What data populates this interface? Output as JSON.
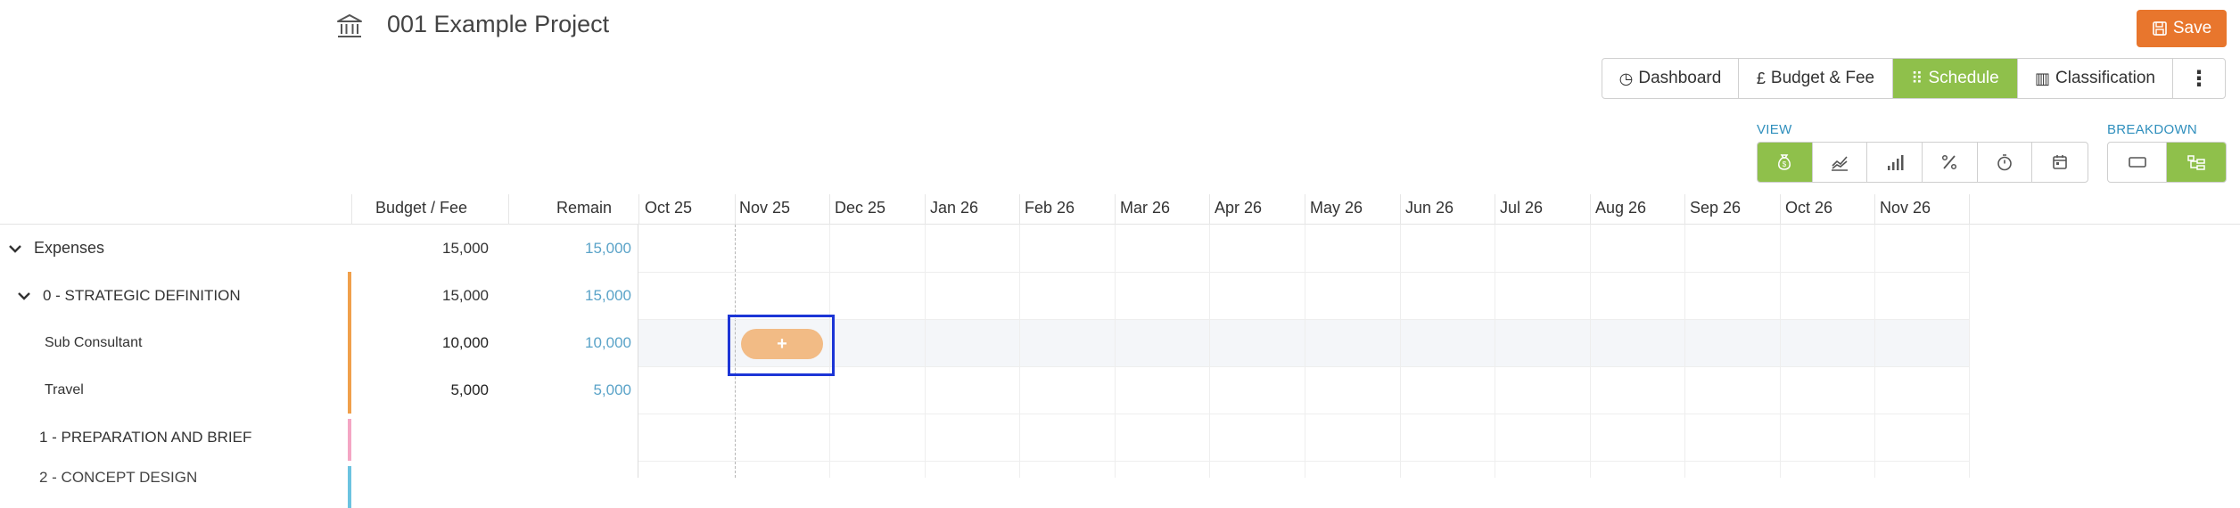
{
  "project": {
    "title": "001 Example Project",
    "icon": "bank-icon"
  },
  "toolbar": {
    "save_label": "Save"
  },
  "tabs": [
    {
      "label": "Dashboard",
      "icon": "dashboard-icon",
      "glyph": "◷"
    },
    {
      "label": "Budget & Fee",
      "icon": "pound-icon",
      "glyph": "£"
    },
    {
      "label": "Schedule",
      "icon": "schedule-icon",
      "glyph": "⠿",
      "active": true
    },
    {
      "label": "Classification",
      "icon": "barcode-icon",
      "glyph": "▥"
    },
    {
      "label": "",
      "icon": "more-vertical-icon",
      "glyph": "⋮"
    }
  ],
  "view": {
    "label": "VIEW",
    "active_index": 0
  },
  "breakdown": {
    "label": "BREAKDOWN",
    "active_index": 1
  },
  "columns": {
    "budget": "Budget / Fee",
    "remain": "Remain"
  },
  "months": [
    "Oct 25",
    "Nov 25",
    "Dec 25",
    "Jan 26",
    "Feb 26",
    "Mar 26",
    "Apr 26",
    "May 26",
    "Jun 26",
    "Jul 26",
    "Aug 26",
    "Sep 26",
    "Oct 26",
    "Nov 26"
  ],
  "rows": [
    {
      "label": "Expenses",
      "budget": "15,000",
      "remain": "15,000"
    },
    {
      "label": "0 - STRATEGIC DEFINITION",
      "budget": "15,000",
      "remain": "15,000",
      "color": "#f0a04b"
    },
    {
      "label": "Sub Consultant",
      "budget": "10,000",
      "remain": "10,000",
      "color": "#f0a04b"
    },
    {
      "label": "Travel",
      "budget": "5,000",
      "remain": "5,000",
      "color": "#f0a04b"
    },
    {
      "label": "1 - PREPARATION AND BRIEF",
      "budget": "",
      "remain": "",
      "color": "#f4a6c4"
    },
    {
      "label": "2 - CONCEPT DESIGN",
      "budget": "",
      "remain": "",
      "color": "#6cc3e0"
    }
  ],
  "schedule_cell": {
    "label": "+",
    "color": "#f2bb85"
  }
}
